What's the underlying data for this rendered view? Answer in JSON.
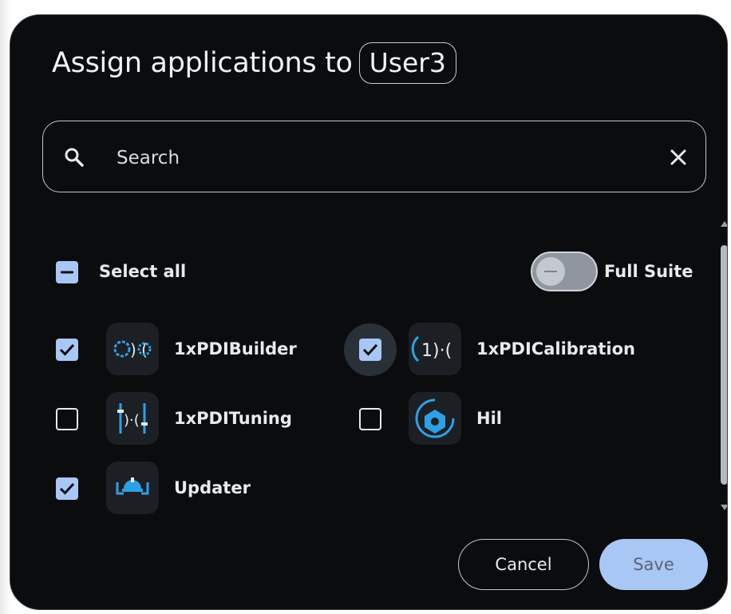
{
  "dialog": {
    "title": "Assign applications to",
    "user": "User3"
  },
  "search": {
    "placeholder": "Search",
    "value": ""
  },
  "select_all": {
    "label": "Select all",
    "state": "indeterminate"
  },
  "full_suite": {
    "label": "Full Suite",
    "enabled": false
  },
  "apps": [
    {
      "name": "1xPDIBuilder",
      "checked": true,
      "icon": "pdi-builder-icon"
    },
    {
      "name": "1xPDICalibration",
      "checked": true,
      "icon": "pdi-calibration-icon"
    },
    {
      "name": "1xPDITuning",
      "checked": false,
      "icon": "pdi-tuning-icon"
    },
    {
      "name": "Hil",
      "checked": false,
      "icon": "hil-icon"
    },
    {
      "name": "Updater",
      "checked": true,
      "icon": "updater-icon"
    }
  ],
  "actions": {
    "cancel_label": "Cancel",
    "save_label": "Save"
  },
  "colors": {
    "background": "#0a0c0e",
    "accent": "#a9c7f5",
    "icon_blue": "#2f9fe6",
    "text": "#e8eaed"
  }
}
